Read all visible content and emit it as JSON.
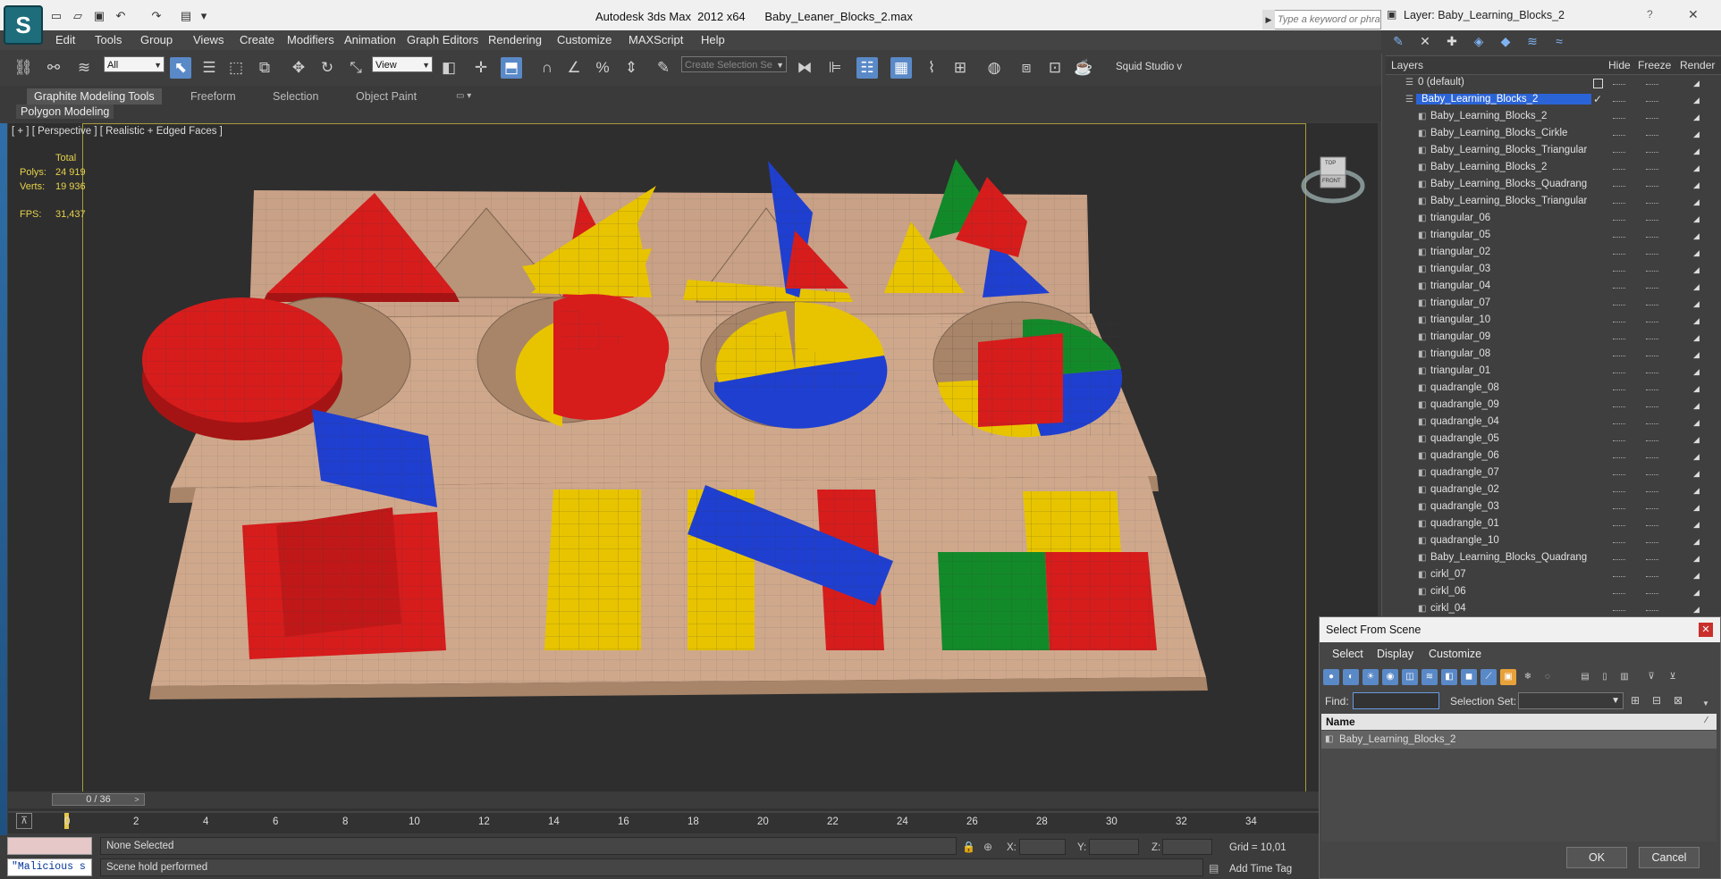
{
  "app": {
    "title": "Autodesk 3ds Max  2012 x64",
    "file": "Baby_Leaner_Blocks_2.max",
    "logo_letter": "S",
    "search_placeholder": "Type a keyword or phrase"
  },
  "menu": [
    "Edit",
    "Tools",
    "Group",
    "Views",
    "Create",
    "Modifiers",
    "Animation",
    "Graph Editors",
    "Rendering",
    "Customize",
    "MAXScript",
    "Help"
  ],
  "toolbar": {
    "selection_filter": "All",
    "ref_coord": "View",
    "named_selection_placeholder": "Create Selection Se",
    "plugin_label": "Squid Studio v"
  },
  "ribbon": {
    "tabs": [
      "Graphite Modeling Tools",
      "Freeform",
      "Selection",
      "Object Paint"
    ],
    "active_tab": "Graphite Modeling Tools",
    "panel": "Polygon Modeling"
  },
  "viewport": {
    "label": "[ + ] [ Perspective ] [ Realistic + Edged Faces ]",
    "stats": {
      "total_label": "Total",
      "polys_label": "Polys:",
      "polys": "24 919",
      "verts_label": "Verts:",
      "verts": "19 936",
      "fps_label": "FPS:",
      "fps": "31,437"
    },
    "viewcube": {
      "top": "TOP",
      "front": "FRONT"
    }
  },
  "timeline": {
    "frame_display": "0 / 36",
    "ticks": [
      "0",
      "2",
      "4",
      "6",
      "8",
      "10",
      "12",
      "14",
      "16",
      "18",
      "20",
      "22",
      "24",
      "26",
      "28",
      "30",
      "32",
      "34"
    ]
  },
  "status": {
    "selection": "None Selected",
    "prompt": "Scene hold performed",
    "x_label": "X:",
    "y_label": "Y:",
    "z_label": "Z:",
    "grid": "Grid = 10,01",
    "add_time_tag": "Add Time Tag",
    "listener_text": "\"Malicious s"
  },
  "layers": {
    "title": "Layer: Baby_Learning_Blocks_2",
    "help": "?",
    "close": "✕",
    "columns": {
      "layers": "Layers",
      "hide": "Hide",
      "freeze": "Freeze",
      "render": "Render"
    },
    "rows": [
      {
        "name": "0 (default)",
        "level": 0
      },
      {
        "name": "Baby_Learning_Blocks_2",
        "level": 0,
        "selected": true
      },
      {
        "name": "Baby_Learning_Blocks_2",
        "level": 1
      },
      {
        "name": "Baby_Learning_Blocks_Cirkle",
        "level": 1
      },
      {
        "name": "Baby_Learning_Blocks_Triangular",
        "level": 1
      },
      {
        "name": "Baby_Learning_Blocks_2",
        "level": 1
      },
      {
        "name": "Baby_Learning_Blocks_Quadrangle",
        "level": 1
      },
      {
        "name": "Baby_Learning_Blocks_Triangular_B",
        "level": 1
      },
      {
        "name": "triangular_06",
        "level": 1
      },
      {
        "name": "triangular_05",
        "level": 1
      },
      {
        "name": "triangular_02",
        "level": 1
      },
      {
        "name": "triangular_03",
        "level": 1
      },
      {
        "name": "triangular_04",
        "level": 1
      },
      {
        "name": "triangular_07",
        "level": 1
      },
      {
        "name": "triangular_10",
        "level": 1
      },
      {
        "name": "triangular_09",
        "level": 1
      },
      {
        "name": "triangular_08",
        "level": 1
      },
      {
        "name": "triangular_01",
        "level": 1
      },
      {
        "name": "quadrangle_08",
        "level": 1
      },
      {
        "name": "quadrangle_09",
        "level": 1
      },
      {
        "name": "quadrangle_04",
        "level": 1
      },
      {
        "name": "quadrangle_05",
        "level": 1
      },
      {
        "name": "quadrangle_06",
        "level": 1
      },
      {
        "name": "quadrangle_07",
        "level": 1
      },
      {
        "name": "quadrangle_02",
        "level": 1
      },
      {
        "name": "quadrangle_03",
        "level": 1
      },
      {
        "name": "quadrangle_01",
        "level": 1
      },
      {
        "name": "quadrangle_10",
        "level": 1
      },
      {
        "name": "Baby_Learning_Blocks_Quadrangle_",
        "level": 1
      },
      {
        "name": "cirkl_07",
        "level": 1
      },
      {
        "name": "cirkl_06",
        "level": 1
      },
      {
        "name": "cirkl_04",
        "level": 1
      }
    ]
  },
  "select_from_scene": {
    "title": "Select From Scene",
    "menu": [
      "Select",
      "Display",
      "Customize"
    ],
    "find_label": "Find:",
    "selection_set_label": "Selection Set:",
    "name_column": "Name",
    "items": [
      "Baby_Learning_Blocks_2"
    ],
    "ok": "OK",
    "cancel": "Cancel"
  },
  "colors": {
    "block_red": "#d71c1c",
    "block_yellow": "#e8c400",
    "block_blue": "#1f3fd0",
    "block_green": "#138a2a",
    "wood": "#cfa88c",
    "viewport_bg": "#2e2e2e",
    "selection_blue": "#2b64d6"
  }
}
